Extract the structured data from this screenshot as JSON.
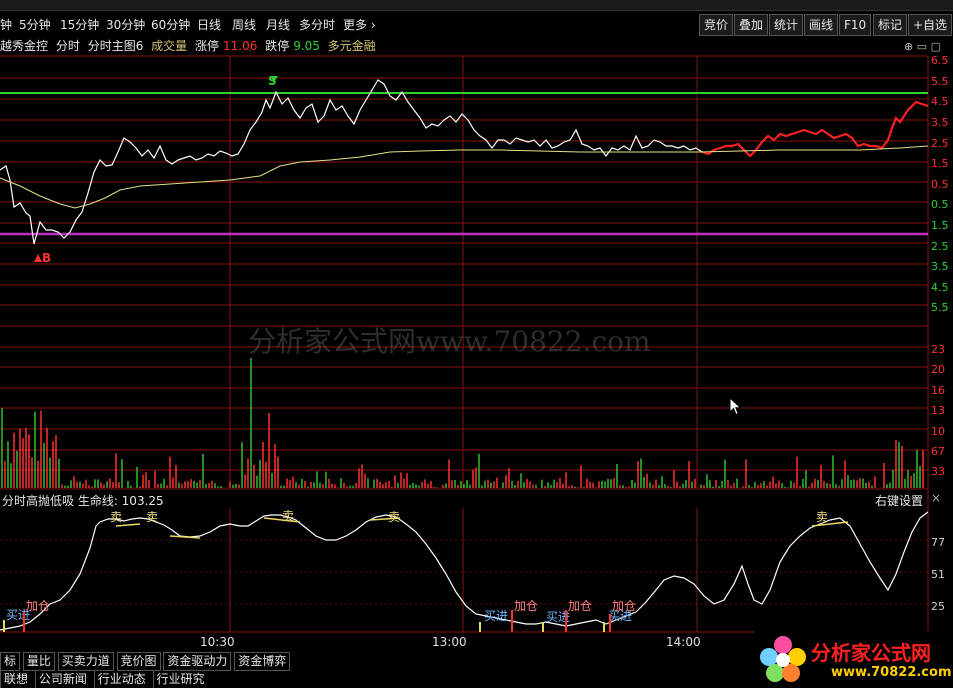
{
  "toolbar": {
    "periods": [
      "钟",
      "5分钟",
      "15分钟",
      "30分钟",
      "60分钟",
      "日线",
      "周线",
      "月线",
      "多分时",
      "更多 ›"
    ],
    "right_buttons": [
      "竞价",
      "叠加",
      "统计",
      "画线",
      "F10",
      "标记",
      "+自选"
    ]
  },
  "info": {
    "stock_name": "越秀金控",
    "mode": "分时",
    "main_chart": "分时主图6",
    "volume_label": "成交量",
    "limit_up_label": "涨停",
    "limit_up_value": "11.06",
    "limit_down_label": "跌停",
    "limit_down_value": "9.05",
    "extra": "多元金融"
  },
  "price_axis_labels": [
    "6.5",
    "5.5",
    "4.5",
    "3.5",
    "2.5",
    "1.5",
    "0.5",
    "0.5",
    "1.5",
    "2.5",
    "3.5",
    "4.5",
    "5.5"
  ],
  "volume_axis_labels": [
    "23",
    "20",
    "16",
    "13",
    "10",
    "67",
    "33"
  ],
  "indicator_axis_labels": [
    "77",
    "51",
    "25"
  ],
  "markers": {
    "sell_marker": "S",
    "buy_marker": "B"
  },
  "indicator": {
    "title": "分时高抛低吸 生命线: 103.25",
    "right_click": "右键设置",
    "close": "×",
    "sell_signal": "卖",
    "buy_signal": "买进",
    "add_signal": "加仓"
  },
  "time_axis": [
    "10:30",
    "13:00",
    "14:00"
  ],
  "tabs": [
    "标",
    "量比",
    "买卖力道",
    "竞价图",
    "资金驱动力",
    "资金博弈"
  ],
  "tabs2": [
    "联想",
    "公司新闻",
    "行业动态",
    "行业研究"
  ],
  "watermark": "分析家公式网www.70822.com",
  "logo": {
    "title": "分析家公式网",
    "url": "www.70822.com"
  },
  "colors": {
    "grid": "#8a1010",
    "price_line": "#ffffff",
    "price_up": "#ff2020",
    "avg_line": "#e6e08a",
    "resistance": "#2fd02f",
    "support": "#c030c0",
    "vol_up": "#ff3030",
    "vol_down": "#30c030"
  }
}
